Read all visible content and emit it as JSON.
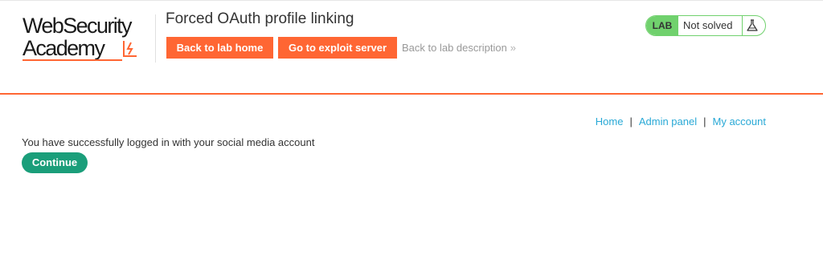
{
  "header": {
    "logo_line1": "WebSecurity",
    "logo_line2": "Academy",
    "lab_title": "Forced OAuth profile linking",
    "buttons": {
      "back_to_lab_home": "Back to lab home",
      "go_to_exploit_server": "Go to exploit server"
    },
    "back_to_description": "Back to lab description",
    "back_chevron": "»",
    "lab_status": {
      "badge": "LAB",
      "state": "Not solved",
      "icon": "flask-icon"
    }
  },
  "nav": {
    "home": "Home",
    "admin_panel": "Admin panel",
    "my_account": "My account",
    "separator": "|"
  },
  "main": {
    "message": "You have successfully logged in with your social media account",
    "continue_label": "Continue"
  },
  "colors": {
    "brand_orange": "#ff6633",
    "lab_green": "#70d16d",
    "link_blue": "#29a9d6",
    "continue_green": "#1a9e7a"
  }
}
